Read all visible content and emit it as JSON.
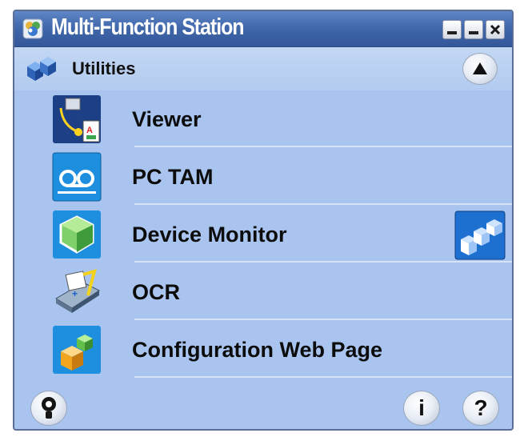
{
  "window": {
    "title": "Multi-Function Station",
    "buttons": {
      "minimize": "minimize",
      "restore": "restore",
      "close": "close"
    }
  },
  "section": {
    "label": "Utilities",
    "collapse_icon": "triangle-up-icon"
  },
  "items": [
    {
      "label": "Viewer",
      "icon": "viewer-icon"
    },
    {
      "label": "PC TAM",
      "icon": "voicemail-icon"
    },
    {
      "label": "Device Monitor",
      "icon": "device-monitor-icon",
      "extra_icon": "device-status-icon"
    },
    {
      "label": "OCR",
      "icon": "ocr-scanner-icon"
    },
    {
      "label": "Configuration Web Page",
      "icon": "web-config-icon"
    }
  ],
  "footer": {
    "left_icon": "bulb-help-icon",
    "info_label": "i",
    "help_label": "?"
  },
  "colors": {
    "titlebar": "#3f66a9",
    "panel": "#a9c4ee",
    "header": "#b8cff0"
  }
}
